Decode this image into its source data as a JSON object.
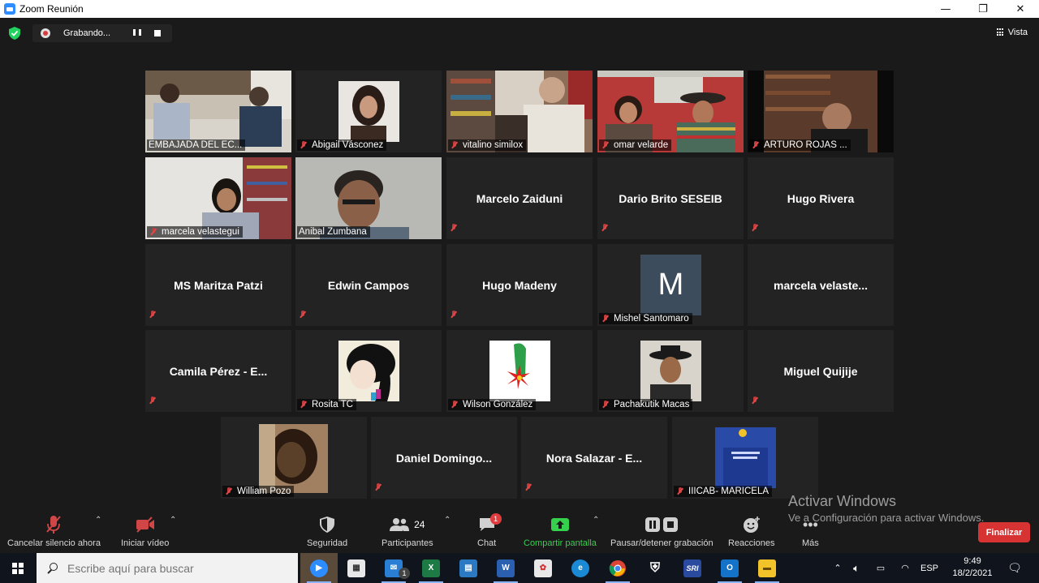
{
  "window": {
    "title": "Zoom Reunión",
    "minimize": "—",
    "restore": "❐",
    "close": "✕"
  },
  "recording": {
    "status": "Grabando..."
  },
  "view_label": "Vista",
  "participants_tiles": [
    {
      "name": "EMBAJADA DEL EC...",
      "video": true,
      "muted": false
    },
    {
      "name": "Abigail Vásconez",
      "video": true,
      "muted": true
    },
    {
      "name": "vitalino similox",
      "video": true,
      "muted": true
    },
    {
      "name": "omar velarde",
      "video": true,
      "muted": true
    },
    {
      "name": "ARTURO ROJAS ...",
      "video": true,
      "muted": true
    },
    {
      "name": "marcela velastegui",
      "video": true,
      "muted": true
    },
    {
      "name": "Anibal Zumbana",
      "video": true,
      "muted": false,
      "active_speaker": true
    },
    {
      "name": "Marcelo Zaiduni",
      "video": false,
      "muted": true
    },
    {
      "name": "Dario Brito SESEIB",
      "video": false,
      "muted": true
    },
    {
      "name": "Hugo Rivera",
      "video": false,
      "muted": true
    },
    {
      "name": "MS Maritza Patzi",
      "video": false,
      "muted": true
    },
    {
      "name": "Edwin Campos",
      "video": false,
      "muted": true
    },
    {
      "name": "Hugo Madeny",
      "video": false,
      "muted": true
    },
    {
      "name": "Mishel Santomaro",
      "video": false,
      "muted": true,
      "avatar_letter": "M"
    },
    {
      "name": "marcela  velaste...",
      "video": false,
      "muted": false
    },
    {
      "name": "Camila Pérez - E...",
      "video": false,
      "muted": true
    },
    {
      "name": "Rosita TC",
      "video": false,
      "muted": true,
      "has_photo": true
    },
    {
      "name": "Wilson González",
      "video": false,
      "muted": true,
      "has_photo": true
    },
    {
      "name": "Pachakutik Macas",
      "video": false,
      "muted": true,
      "has_photo": true
    },
    {
      "name": "Miguel Quijije",
      "video": false,
      "muted": true
    },
    {
      "name": "William Pozo",
      "video": false,
      "muted": true,
      "has_photo": true
    },
    {
      "name": "Daniel  Domingo...",
      "video": false,
      "muted": true
    },
    {
      "name": "Nora Salazar - E...",
      "video": false,
      "muted": true
    },
    {
      "name": "IIICAB- MARICELA",
      "video": false,
      "muted": true,
      "has_photo": true
    }
  ],
  "toolbar": {
    "unmute": "Cancelar silencio ahora",
    "start_video": "Iniciar vídeo",
    "security": "Seguridad",
    "participants": "Participantes",
    "participants_count": "24",
    "chat": "Chat",
    "chat_badge": "1",
    "share": "Compartir pantalla",
    "pause_recording": "Pausar/detener grabación",
    "reactions": "Reacciones",
    "more": "Más",
    "end": "Finalizar"
  },
  "activation": {
    "line1": "Activar Windows",
    "line2": "Ve a Configuración para activar Windows."
  },
  "taskbar": {
    "search_placeholder": "Escribe aquí para buscar",
    "mail_badge": "1",
    "language": "ESP",
    "time": "9:49",
    "date": "18/2/2021"
  },
  "colors": {
    "active_speaker_border": "#f5f37a",
    "share_green": "#35d14c",
    "end_red": "#d83333",
    "zoom_blue": "#2d8cff"
  }
}
